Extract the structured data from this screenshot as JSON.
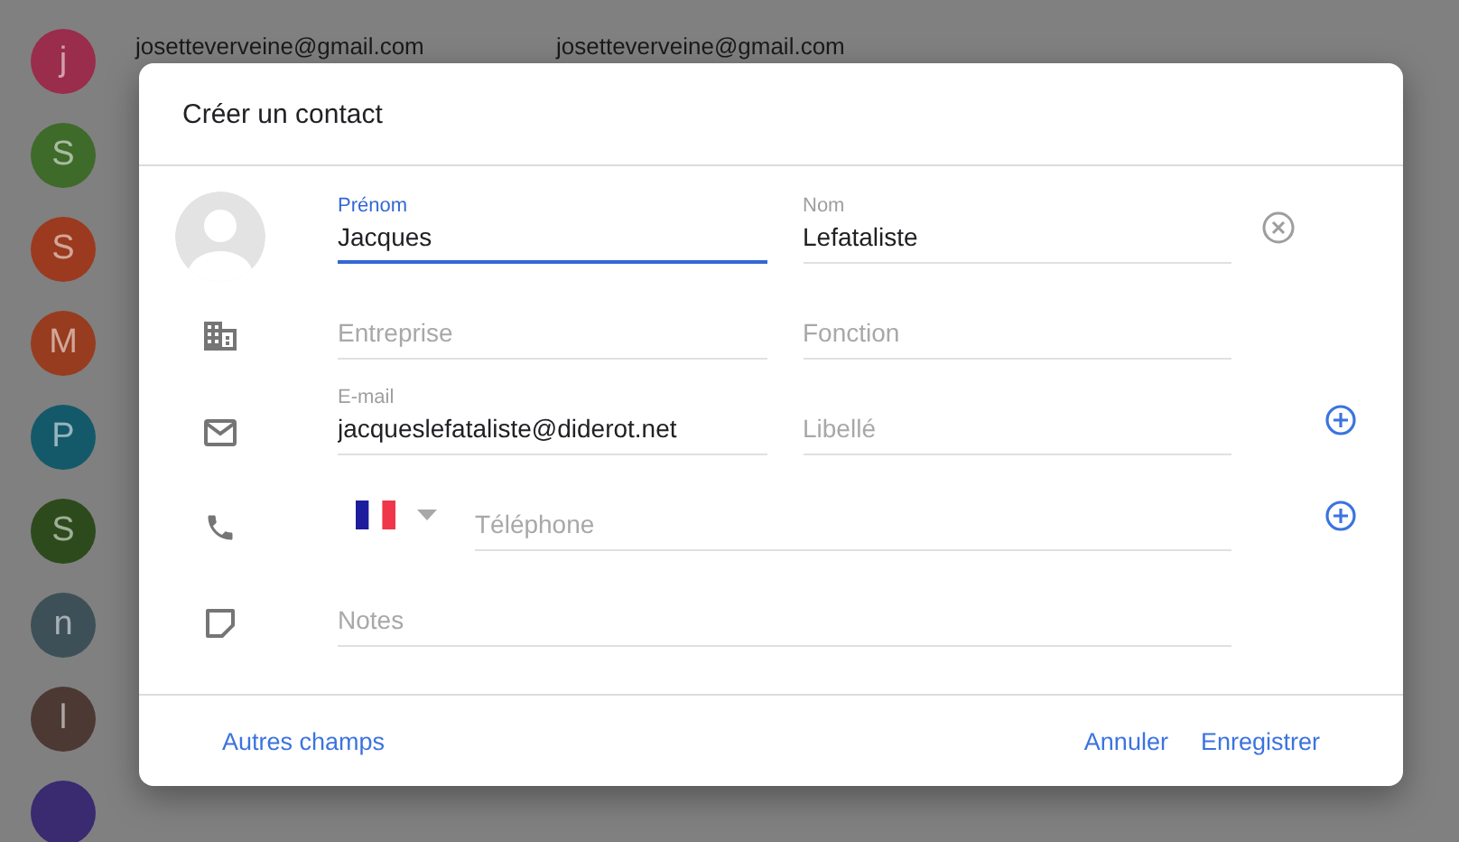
{
  "contacts": [
    {
      "initial": "j",
      "color": "#9a2c4c",
      "emails": [
        "josetteverveine@gmail.com",
        "josetteverveine@gmail.com"
      ]
    },
    {
      "initial": "S",
      "color": "#3e6a2a"
    },
    {
      "initial": "S",
      "color": "#9b3a1e"
    },
    {
      "initial": "M",
      "color": "#973c1e"
    },
    {
      "initial": "P",
      "color": "#14596a"
    },
    {
      "initial": "S",
      "color": "#2d4a1c"
    },
    {
      "initial": "n",
      "color": "#3d5058"
    },
    {
      "initial": "l",
      "color": "#4c3934"
    },
    {
      "color": "#3a2a70"
    }
  ],
  "dialog": {
    "title": "Créer un contact",
    "rows": [
      {
        "kind": "name",
        "fields": [
          {
            "label": "Prénom",
            "value": "Jacques",
            "focused": true
          },
          {
            "label": "Nom",
            "value": "Lefataliste",
            "focused": false
          }
        ]
      },
      {
        "kind": "company",
        "fields": [
          {
            "placeholder": "Entreprise",
            "focused": false
          },
          {
            "placeholder": "Fonction",
            "focused": false
          }
        ]
      },
      {
        "kind": "email",
        "fields": [
          {
            "label": "E-mail",
            "value": "jacqueslefataliste@diderot.net",
            "focused": false
          },
          {
            "placeholder": "Libellé",
            "focused": false
          }
        ]
      },
      {
        "kind": "phone",
        "fields": [
          {
            "placeholder": "Téléphone",
            "focused": false
          }
        ]
      },
      {
        "kind": "notes",
        "fields": [
          {
            "placeholder": "Notes",
            "focused": false
          }
        ]
      }
    ],
    "footer": {
      "left": "Autres champs",
      "buttons": [
        "Annuler",
        "Enregistrer"
      ]
    }
  }
}
